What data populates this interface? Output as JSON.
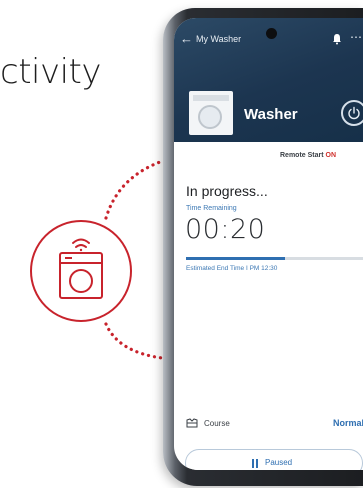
{
  "headline": "ctivity",
  "app": {
    "back_icon": "arrow-left-icon",
    "title": "My Washer",
    "notification_icon": "bell-icon",
    "more_icon": "more-dots-icon"
  },
  "device": {
    "name": "Washer",
    "thumbnail_icon": "washer-icon",
    "power_icon": "power-icon"
  },
  "remote_start": {
    "label": "Remote Start",
    "state": "ON"
  },
  "status": {
    "title": "In progress...",
    "time_remaining_label": "Time Remaining",
    "time_remaining": "00:20",
    "progress_fraction": 0.55,
    "end_time": "Estimated End Time I PM 12:30"
  },
  "course": {
    "icon": "course-icon",
    "label": "Course",
    "value": "Normal"
  },
  "pause_button": {
    "icon": "pause-icon",
    "label": "Paused"
  },
  "colors": {
    "header_bg": "#1c3550",
    "accent_blue": "#2f6fb1",
    "accent_red": "#d0312d",
    "connection_red": "#c8232c"
  }
}
